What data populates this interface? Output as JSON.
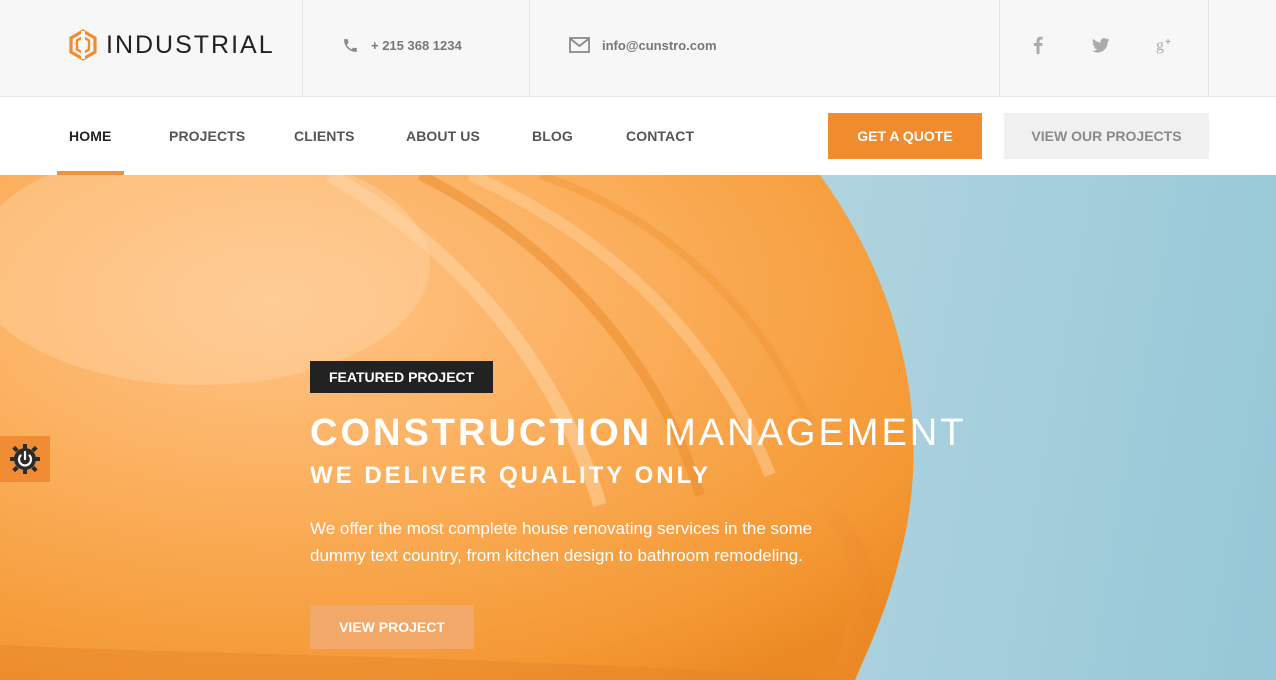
{
  "brand": {
    "name": "INDUSTRIAL",
    "accent": "#f08c2e",
    "logo_icon": "hexagon-logo-icon"
  },
  "topbar": {
    "phone": {
      "icon": "phone-icon",
      "text": "+ 215 368 1234"
    },
    "email": {
      "icon": "envelope-icon",
      "text": "info@cunstro.com"
    },
    "social": [
      {
        "name": "facebook",
        "icon": "facebook-icon"
      },
      {
        "name": "twitter",
        "icon": "twitter-icon"
      },
      {
        "name": "google-plus",
        "icon": "google-plus-icon"
      }
    ]
  },
  "nav": {
    "items": [
      {
        "label": "HOME",
        "active": true
      },
      {
        "label": "PROJECTS",
        "active": false
      },
      {
        "label": "CLIENTS",
        "active": false
      },
      {
        "label": "ABOUT US",
        "active": false
      },
      {
        "label": "BLOG",
        "active": false
      },
      {
        "label": "CONTACT",
        "active": false
      }
    ],
    "quote_button": "GET A QUOTE",
    "view_projects_button": "VIEW OUR PROJECTS"
  },
  "hero": {
    "badge": "FEATURED PROJECT",
    "title_strong": "CONSTRUCTION",
    "title_light": "MANAGEMENT",
    "subtitle": "WE DELIVER QUALITY ONLY",
    "description": "We offer the most complete house renovating services in the some dummy text country, from kitchen design to bathroom remodeling.",
    "button": "VIEW PROJECT",
    "background_image": "orange hard hat against sky",
    "settings_icon": "power-gear-icon"
  },
  "colors": {
    "accent": "#f08c2e",
    "dark": "#222222",
    "sky": "#b0d4df",
    "helmet": "#f7a84b"
  }
}
